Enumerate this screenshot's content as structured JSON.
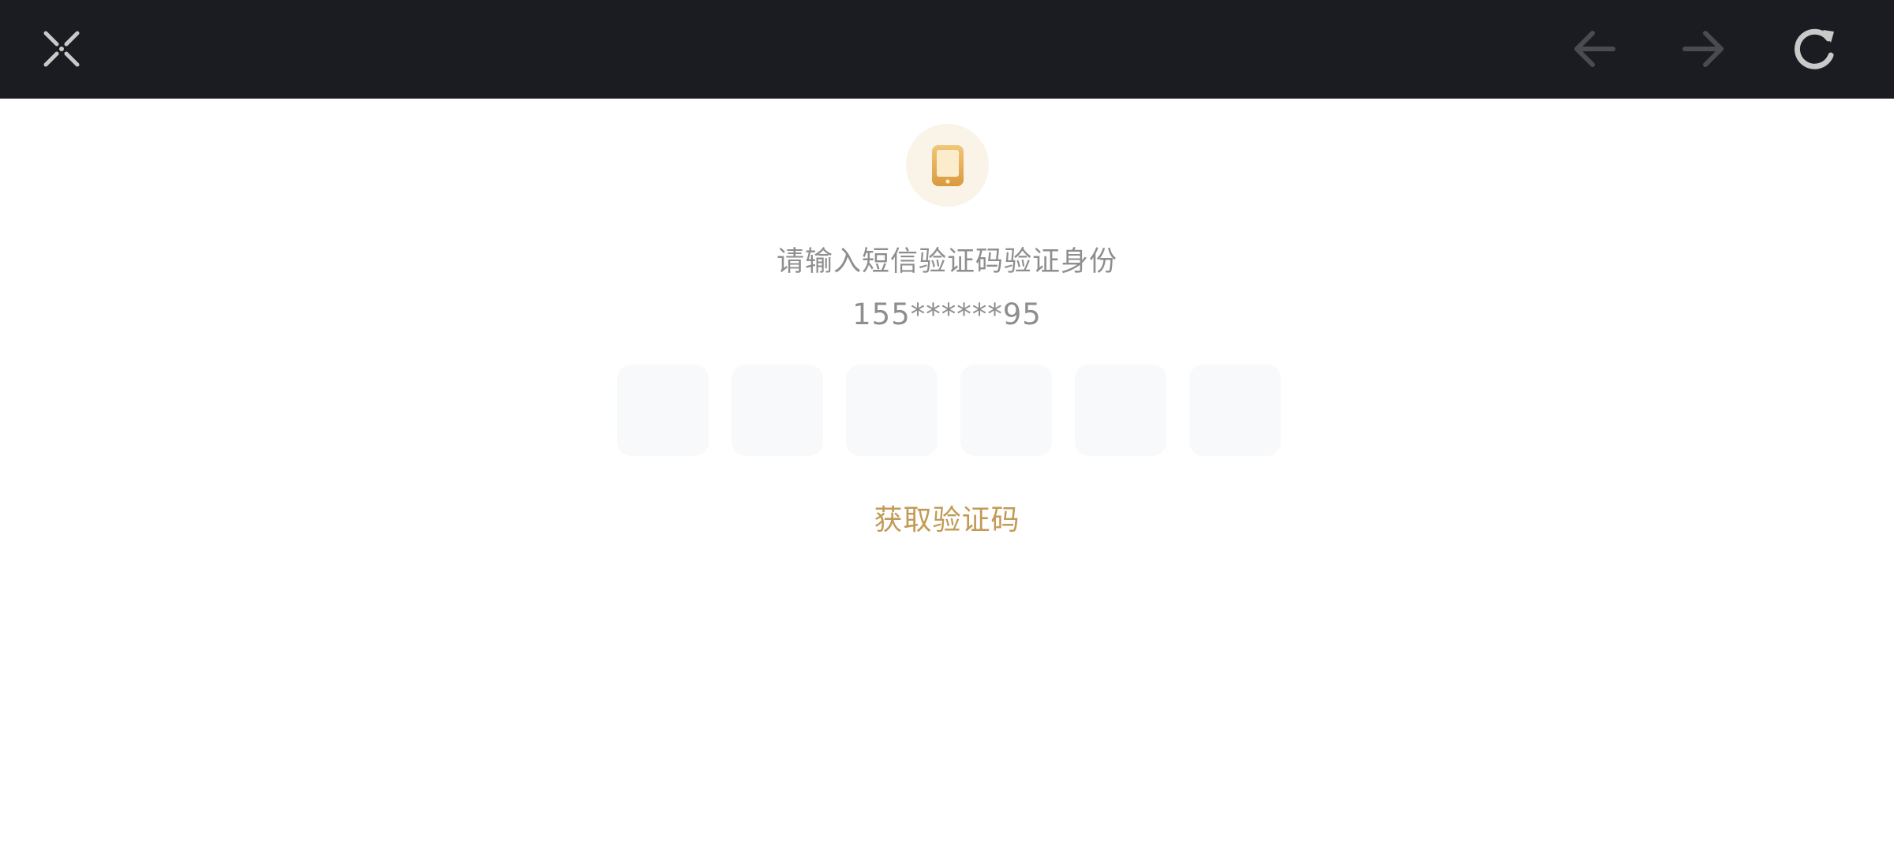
{
  "toolbar": {
    "close_icon": "close-collapse-icon",
    "back_icon": "arrow-left-icon",
    "forward_icon": "arrow-right-icon",
    "refresh_icon": "refresh-icon"
  },
  "verify": {
    "badge_icon": "phone-icon",
    "title": "请输入短信验证码验证身份",
    "phone_number": "155******95",
    "code_digits": [
      "",
      "",
      "",
      "",
      "",
      ""
    ],
    "get_code_label": "获取验证码"
  },
  "colors": {
    "topbar_bg": "#1b1c21",
    "accent_gold": "#c29a55",
    "badge_bg": "#faf3e7",
    "text_gray": "#8e8e8e",
    "box_bg": "#f8f9fb"
  }
}
